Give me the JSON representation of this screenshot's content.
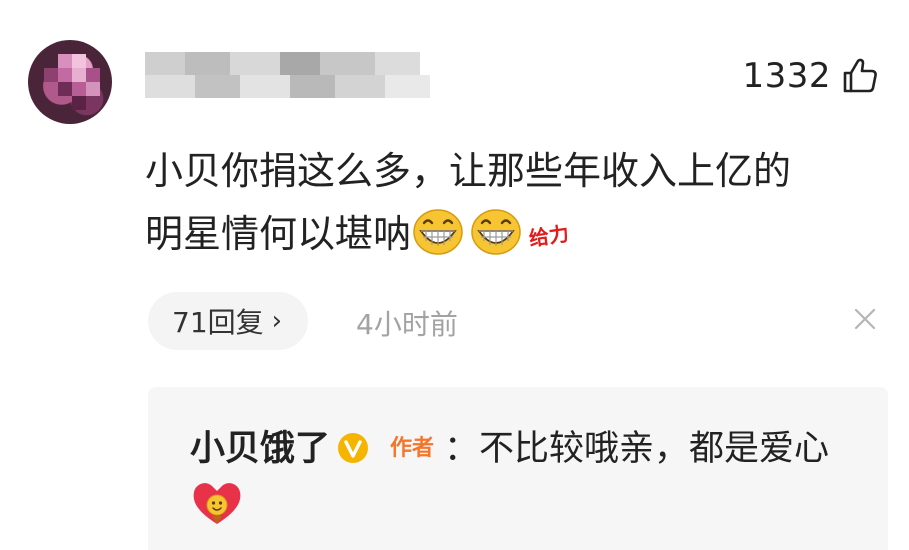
{
  "comment": {
    "avatar_icon": "user-avatar-blurred",
    "username_icon": "username-blurred",
    "like_count": "1332",
    "like_icon": "thumbs-up-icon",
    "text_line1": "小贝你捐这么多，让那些年收入上亿的",
    "text_line2": "明星情何以堪呐",
    "emojis": [
      "grin-emoji",
      "grin-emoji"
    ],
    "sticker_text": "给力",
    "reply_count_label": "71回复",
    "reply_chevron": "›",
    "timestamp": "4小时前",
    "close_icon": "close-icon"
  },
  "reply": {
    "author": "小贝饿了",
    "verified_icon": "verified-v-icon",
    "author_tag": "作者",
    "separator": "：",
    "text": "不比较哦亲，都是爱心",
    "emoji": "heart-emoji"
  },
  "colors": {
    "accent_orange": "#f5752a",
    "verified_gold": "#f5b400",
    "sticker_red": "#e21b1b",
    "muted_text": "#a3a3a3",
    "pill_bg": "#f4f4f4",
    "reply_bg": "#f6f6f7"
  }
}
